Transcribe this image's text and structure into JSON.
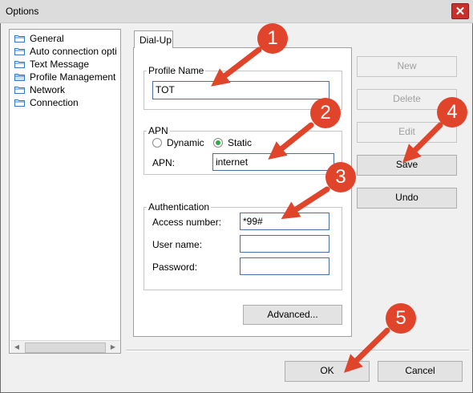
{
  "window": {
    "title": "Options",
    "close_glyph": "✕"
  },
  "sidebar": {
    "items": [
      {
        "label": "General",
        "icon": "folder-icon"
      },
      {
        "label": "Auto connection opti",
        "icon": "folder-icon"
      },
      {
        "label": "Text Message",
        "icon": "folder-icon"
      },
      {
        "label": "Profile Management",
        "icon": "folder-icon"
      },
      {
        "label": "Network",
        "icon": "folder-icon"
      },
      {
        "label": "Connection",
        "icon": "folder-icon"
      }
    ],
    "selected_index": 3
  },
  "tabs": [
    {
      "label": "Dial-Up"
    }
  ],
  "profile": {
    "group_label": "Profile Name",
    "name_value": "TOT"
  },
  "apn": {
    "group_label": "APN",
    "dynamic_label": "Dynamic",
    "static_label": "Static",
    "selected": "Static",
    "field_label": "APN:",
    "field_value": "internet"
  },
  "auth": {
    "group_label": "Authentication",
    "access_label": "Access number:",
    "access_value": "*99#",
    "user_label": "User name:",
    "user_value": "",
    "password_label": "Password:",
    "password_value": ""
  },
  "buttons": {
    "new": "New",
    "delete": "Delete",
    "edit": "Edit",
    "save": "Save",
    "undo": "Undo",
    "advanced": "Advanced...",
    "ok": "OK",
    "cancel": "Cancel"
  },
  "annotations": {
    "markers": [
      "1",
      "2",
      "3",
      "4",
      "5"
    ],
    "color": "#e0452c"
  },
  "colors": {
    "accent_radio": "#2fa84a",
    "close_button": "#c9302c"
  }
}
